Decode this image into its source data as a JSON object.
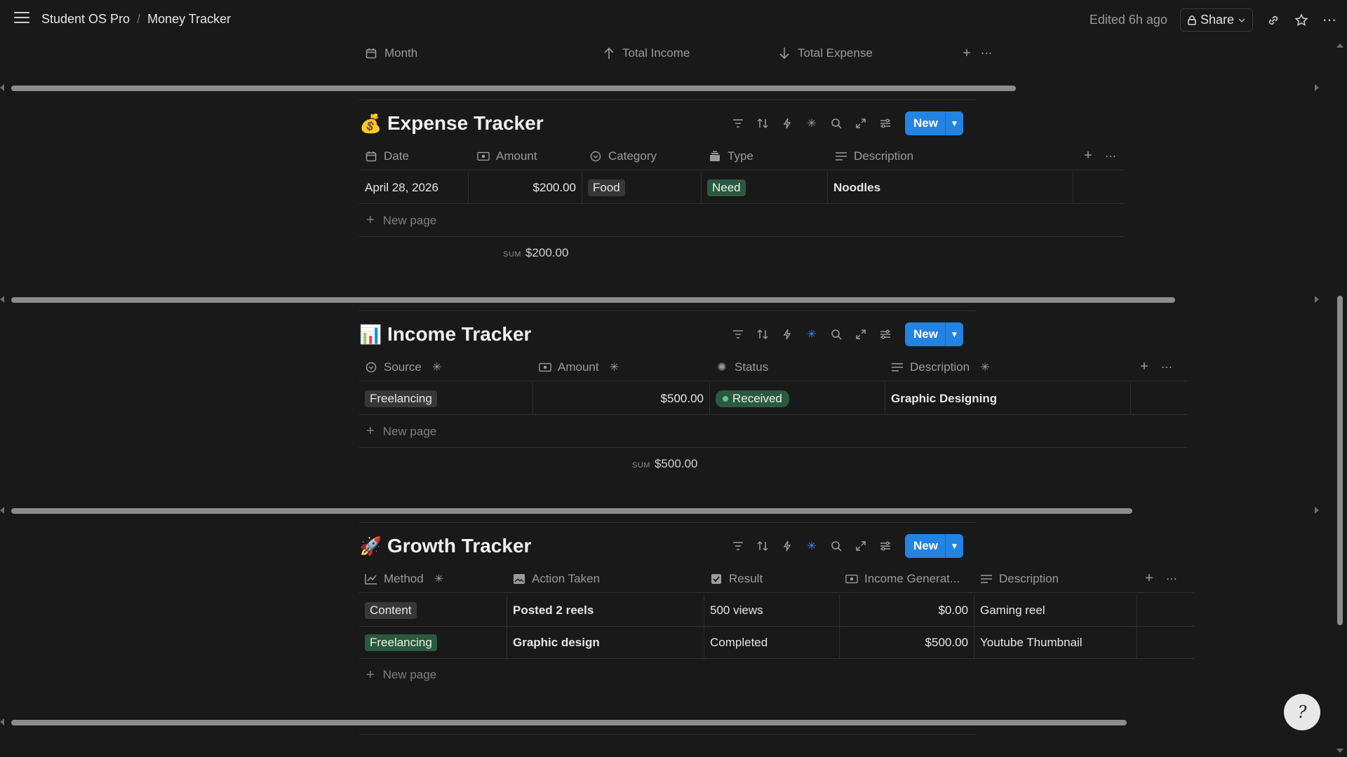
{
  "topbar": {
    "breadcrumbs": [
      "Student OS Pro",
      "Money Tracker"
    ],
    "edited": "Edited 6h ago",
    "share_label": "Share"
  },
  "monthly_view": {
    "columns": [
      "Month",
      "Total Income",
      "Total Expense"
    ]
  },
  "expense": {
    "emoji": "💰",
    "title": "Expense Tracker",
    "new_label": "New",
    "columns": [
      "Date",
      "Amount",
      "Category",
      "Type",
      "Description"
    ],
    "rows": [
      {
        "date": "April 28, 2026",
        "amount": "$200.00",
        "category": "Food",
        "type": "Need",
        "description": "Noodles"
      }
    ],
    "new_page": "New page",
    "sum_key": "SUM",
    "sum_value": "$200.00"
  },
  "income": {
    "emoji": "📊",
    "title": "Income Tracker",
    "new_label": "New",
    "columns": [
      "Source",
      "Amount",
      "Status",
      "Description"
    ],
    "rows": [
      {
        "source": "Freelancing",
        "amount": "$500.00",
        "status": "Received",
        "description": "Graphic Designing"
      }
    ],
    "new_page": "New page",
    "sum_key": "SUM",
    "sum_value": "$500.00"
  },
  "growth": {
    "emoji": "🚀",
    "title": "Growth Tracker",
    "new_label": "New",
    "columns": [
      "Method",
      "Action Taken",
      "Result",
      "Income Generat...",
      "Description"
    ],
    "rows": [
      {
        "method": "Content",
        "action": "Posted 2 reels",
        "result": "500 views",
        "income": "$0.00",
        "description": "Gaming reel"
      },
      {
        "method": "Freelancing",
        "action": "Graphic design",
        "result": "Completed",
        "income": "$500.00",
        "description": "Youtube Thumbnail"
      }
    ],
    "new_page": "New page"
  },
  "colors": {
    "accent": "#2383e2",
    "background": "#191919",
    "tag_green": "#2b593f",
    "tag_gray": "#373737"
  },
  "icons": [
    "menu-icon",
    "lock-icon",
    "link-icon",
    "star-icon",
    "more-icon",
    "filter-icon",
    "sort-icon",
    "bolt-icon",
    "sparkle-icon",
    "search-icon",
    "expand-icon",
    "settings-icon",
    "help-icon"
  ]
}
